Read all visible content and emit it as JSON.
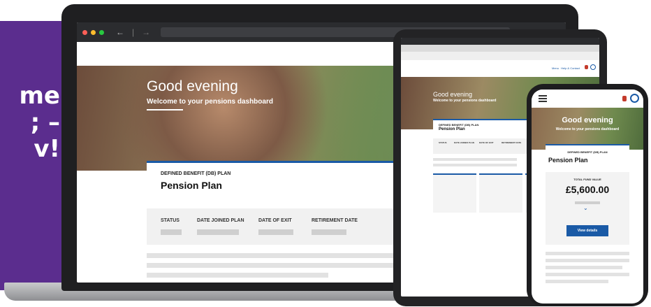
{
  "banner": {
    "lines": [
      "me",
      "; –",
      "v!"
    ]
  },
  "laptop": {
    "hero": {
      "title": "Good evening",
      "subtitle": "Welcome to your pensions dashboard"
    },
    "plan": {
      "subtitle": "DEFINED BENEFIT (DB) PLAN",
      "title": "Pension Plan",
      "columns": [
        "STATUS",
        "DATE JOINED PLAN",
        "DATE OF EXIT",
        "RETIREMENT DATE"
      ]
    }
  },
  "tablet": {
    "hero": {
      "title": "Good evening",
      "subtitle": "Welcome to your pensions dashboard"
    },
    "nav": {
      "menu": "Menu",
      "help": "Help & Contact"
    },
    "plan": {
      "subtitle": "DEFINED BENEFIT (DB) PLAN",
      "title": "Pension Plan",
      "columns": [
        "STATUS",
        "DATE JOINED PLAN",
        "DATE OF EXIT",
        "RETIREMENT DATE"
      ]
    }
  },
  "phone": {
    "hero": {
      "title": "Good evening",
      "subtitle": "Welcome to your pensions dashboard"
    },
    "plan": {
      "subtitle": "DEFINED BENEFIT (DB) PLAN",
      "title": "Pension Plan"
    },
    "fund": {
      "label": "TOTAL FUND VALUE",
      "value": "£5,600.00",
      "button": "View details"
    }
  },
  "icons": [
    "menu-icon",
    "notification-icon",
    "user-icon",
    "back-arrow-icon",
    "forward-arrow-icon",
    "chevron-down-icon"
  ],
  "colors": {
    "brand_purple": "#5b2d8e",
    "accent_blue": "#1a5aa6",
    "traffic": [
      "#ff5f57",
      "#febc2e",
      "#28c840"
    ]
  }
}
